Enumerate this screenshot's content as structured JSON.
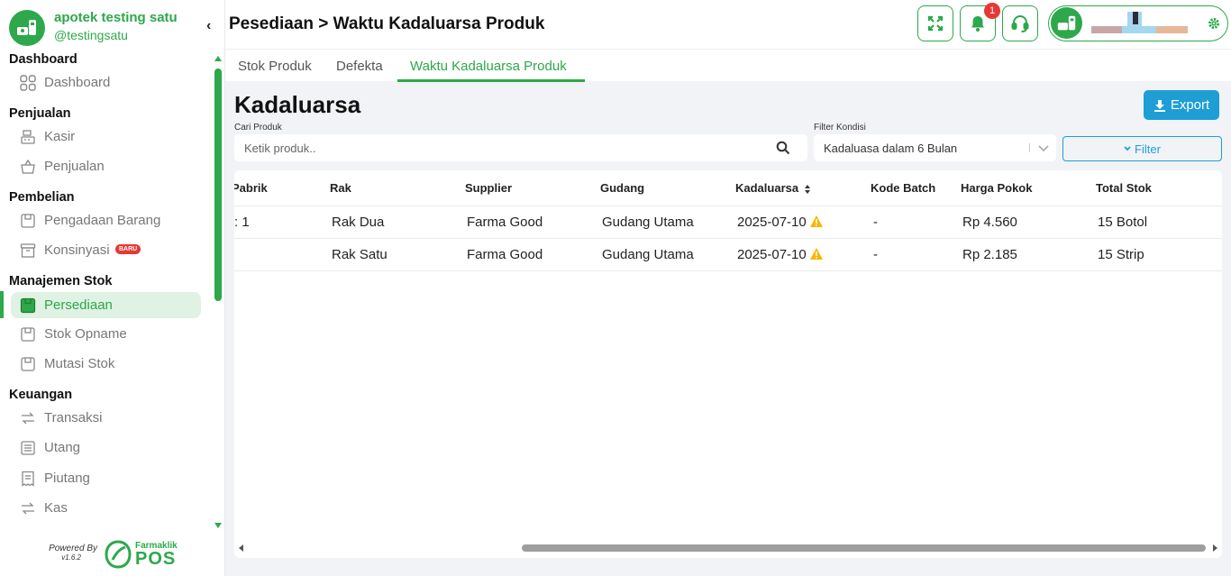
{
  "brand": {
    "name": "apotek testing satu",
    "handle": "@testingsatu"
  },
  "header": {
    "title": "Pesediaan > Waktu Kadaluarsa Produk",
    "notification_count": "1"
  },
  "sidebar": {
    "sections": [
      {
        "title": "Dashboard",
        "items": [
          {
            "label": "Dashboard",
            "icon": "grid-icon"
          }
        ]
      },
      {
        "title": "Penjualan",
        "items": [
          {
            "label": "Kasir",
            "icon": "cash-register-icon"
          },
          {
            "label": "Penjualan",
            "icon": "basket-icon"
          }
        ]
      },
      {
        "title": "Pembelian",
        "items": [
          {
            "label": "Pengadaan Barang",
            "icon": "box-icon"
          },
          {
            "label": "Konsinyasi",
            "icon": "archive-icon",
            "badge": "BARU"
          }
        ]
      },
      {
        "title": "Manajemen Stok",
        "items": [
          {
            "label": "Persediaan",
            "icon": "box-icon",
            "active": true
          },
          {
            "label": "Stok Opname",
            "icon": "box-icon"
          },
          {
            "label": "Mutasi Stok",
            "icon": "box-icon"
          }
        ]
      },
      {
        "title": "Keuangan",
        "items": [
          {
            "label": "Transaksi",
            "icon": "transfer-icon"
          },
          {
            "label": "Utang",
            "icon": "ledger-icon"
          },
          {
            "label": "Piutang",
            "icon": "receipt-icon"
          },
          {
            "label": "Kas",
            "icon": "transfer-icon"
          }
        ]
      }
    ]
  },
  "footer": {
    "powered_by": "Powered By",
    "version": "v1.6.2",
    "logo_line1": "Farmaklik",
    "logo_line2": "POS"
  },
  "tabs": [
    {
      "label": "Stok Produk"
    },
    {
      "label": "Defekta"
    },
    {
      "label": "Waktu Kadaluarsa Produk",
      "active": true
    }
  ],
  "main": {
    "title": "Kadaluarsa",
    "export_label": "Export",
    "search": {
      "label": "Cari Produk",
      "placeholder": "Ketik produk.."
    },
    "filter_kondisi": {
      "label": "Filter Kondisi",
      "value": "Kadaluasa dalam 6 Bulan"
    },
    "filter_button": "Filter"
  },
  "table": {
    "columns": [
      "Pabrik",
      "Rak",
      "Supplier",
      "Gudang",
      "Kadaluarsa",
      "Kode Batch",
      "Harga Pokok",
      "Total Stok"
    ],
    "rows": [
      {
        "pabrik": ": 1",
        "rak": "Rak Dua",
        "supplier": "Farma Good",
        "gudang": "Gudang Utama",
        "kadaluarsa": "2025-07-10",
        "kode_batch": "-",
        "harga_pokok": "Rp 4.560",
        "total_stok": "15 Botol"
      },
      {
        "pabrik": "",
        "rak": "Rak Satu",
        "supplier": "Farma Good",
        "gudang": "Gudang Utama",
        "kadaluarsa": "2025-07-10",
        "kode_batch": "-",
        "harga_pokok": "Rp 2.185",
        "total_stok": "15 Strip"
      }
    ]
  },
  "colors": {
    "primary": "#2da84a",
    "accent": "#1e9ed5",
    "danger": "#e53935",
    "warning": "#f5b800"
  }
}
